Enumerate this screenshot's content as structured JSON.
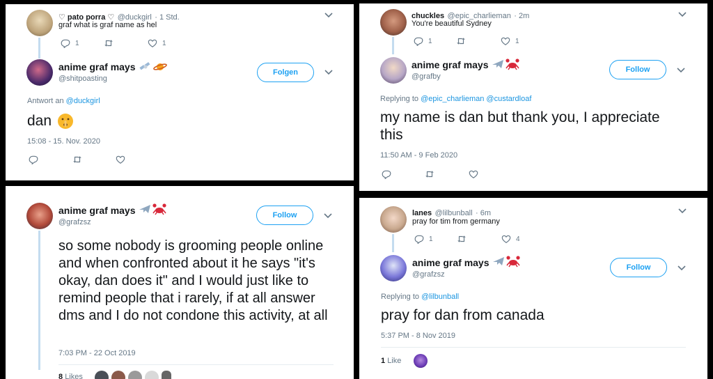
{
  "p1": {
    "reply_name": "♡ pato porra ♡",
    "reply_handle": "@duckgirl",
    "reply_time": "· 1 Std.",
    "reply_text": "graf what is graf name as hel",
    "reply_reply_count": "1",
    "reply_like_count": "1",
    "name": "anime graf mays",
    "handle": "@shitpoasting",
    "follow_label": "Folgen",
    "reply_to_prefix": "Antwort an",
    "reply_to_user": "@duckgirl",
    "tweet_text": "dan",
    "timestamp": "15:08 - 15. Nov. 2020"
  },
  "p2": {
    "reply_name": "chuckles",
    "reply_handle": "@epic_charlieman",
    "reply_time": "· 2m",
    "reply_text": "You're beautiful Sydney",
    "reply_reply_count": "1",
    "reply_like_count": "1",
    "name": "anime graf mays",
    "handle": "@grafby",
    "follow_label": "Follow",
    "reply_to_prefix": "Replying to",
    "reply_to_users": "@epic_charlieman @custardloaf",
    "tweet_text": "my name is dan but thank you, I appreciate this",
    "timestamp": "11:50 AM - 9 Feb 2020"
  },
  "p3": {
    "name": "anime graf mays",
    "handle": "@grafzsz",
    "follow_label": "Follow",
    "tweet_text": "so some nobody is grooming people online and when confronted about it he says \"it's okay, dan does it\" and I would just like to remind people that i rarely, if at all answer dms and I do not condone this activity, at all",
    "timestamp": "7:03 PM - 22 Oct 2019",
    "likes_count": "8",
    "likes_label": "Likes"
  },
  "p4": {
    "reply_name": "lanes",
    "reply_handle": "@lilbunball",
    "reply_time": "· 6m",
    "reply_text": "pray for tim from germany",
    "reply_reply_count": "1",
    "reply_like_count": "4",
    "name": "anime graf mays",
    "handle": "@grafzsz",
    "follow_label": "Follow",
    "reply_to_prefix": "Replying to",
    "reply_to_user": "@lilbunball",
    "tweet_text": "pray for dan from canada",
    "timestamp": "5:37 PM - 8 Nov 2019",
    "likes_count": "1",
    "likes_label": "Like"
  },
  "colors": {
    "accent": "#1da1f2",
    "link": "#1b95e0",
    "muted": "#657786",
    "thread": "#c4dcef"
  }
}
